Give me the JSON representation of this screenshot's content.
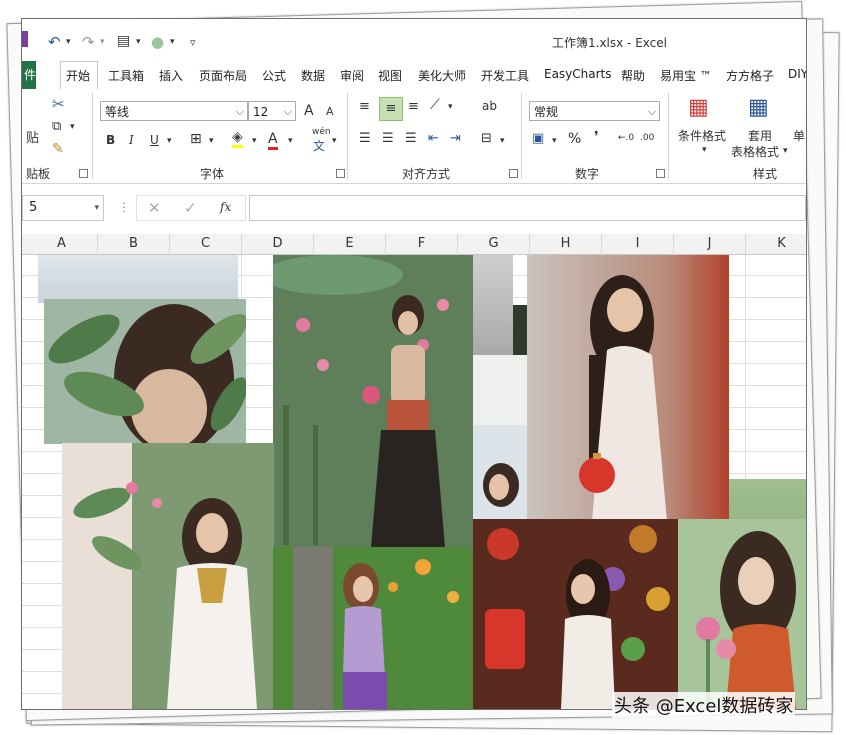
{
  "window": {
    "title": "工作簿1.xlsx  -  Excel",
    "quick_access": [
      "undo-icon",
      "redo-icon",
      "form-icon",
      "circle-icon",
      "customize-icon"
    ]
  },
  "tabs": {
    "file": "件",
    "items": [
      "开始",
      "工具箱",
      "插入",
      "页面布局",
      "公式",
      "数据",
      "审阅",
      "视图",
      "美化大师",
      "开发工具",
      "EasyCharts",
      "帮助",
      "易用宝 ™",
      "方方格子",
      "DIY"
    ]
  },
  "ribbon": {
    "clipboard": {
      "paste": "贴",
      "group": "贴板"
    },
    "font": {
      "name": "等线",
      "size": "12",
      "bold": "B",
      "italic": "I",
      "underline": "U",
      "font_color": "A",
      "phonetic": "wén",
      "phonetic2": "文",
      "grow": "A",
      "shrink": "A",
      "group": "字体"
    },
    "alignment": {
      "group": "对齐方式",
      "wrap": "ab"
    },
    "number": {
      "format": "常规",
      "percent": "%",
      "comma": "❜",
      "group": "数字"
    },
    "styles": {
      "conditional": "条件格式",
      "table_format_1": "套用",
      "table_format_2": "表格格式",
      "cell_styles": "单",
      "group": "样式"
    }
  },
  "formula_bar": {
    "name_box": "5",
    "fx": "fx"
  },
  "columns": [
    "A",
    "B",
    "C",
    "D",
    "E",
    "F",
    "G",
    "H",
    "I",
    "J",
    "K"
  ],
  "watermark": "头条 @Excel数据砖家",
  "colors": {
    "excel_green": "#217346",
    "accent_selected": "#c6e0b4"
  }
}
